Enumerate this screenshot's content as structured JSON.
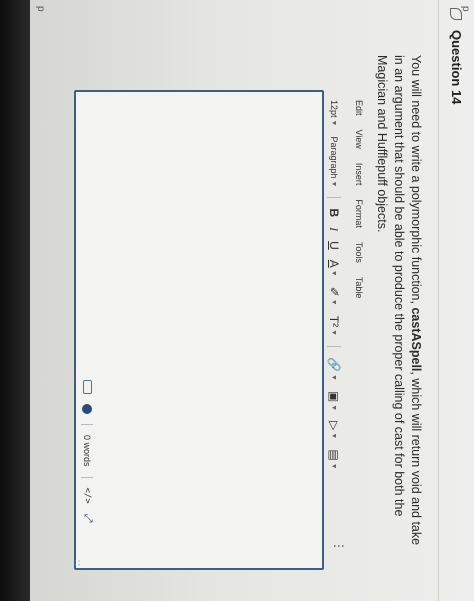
{
  "corner_marks": {
    "top": "p",
    "bottom": "p"
  },
  "question": {
    "title": "Question 14",
    "prompt_before": "You will need to write a polymorphic function, ",
    "prompt_bold": "castASpell",
    "prompt_after": ", which will return void and take in an argument that should be able to produce the proper calling of cast for both the Magician and Hufflepuff objects."
  },
  "editor": {
    "menus": [
      "Edit",
      "View",
      "Insert",
      "Format",
      "Tools",
      "Table"
    ],
    "font_size": "12pt",
    "block_format": "Paragraph",
    "format_buttons": {
      "bold": "B",
      "italic": "I",
      "underline": "U",
      "text_color": "A",
      "highlight": "✐",
      "superscript": "T²"
    },
    "more": "⋮",
    "word_count": "0 words",
    "code_view": "</>",
    "expand": "⤢",
    "resize_grip": "∷"
  },
  "colors": {
    "editor_border": "#3b5f86",
    "page_bg": "#e9e9e6"
  }
}
